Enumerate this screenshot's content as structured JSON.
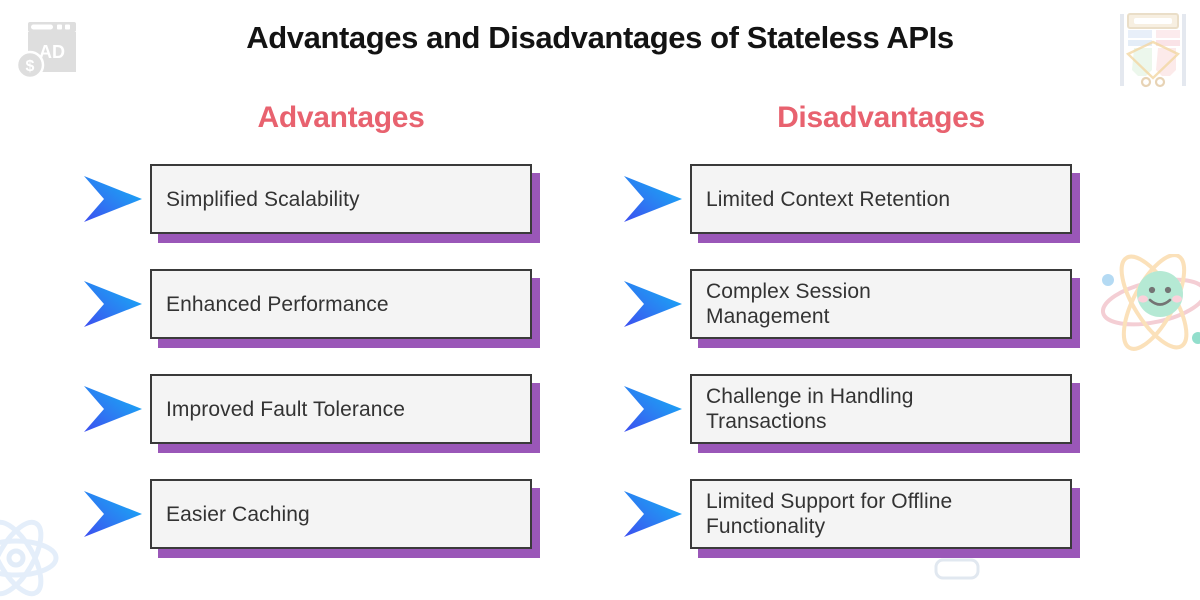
{
  "page": {
    "title": "Advantages and Disadvantages of Stateless APIs",
    "background_color": "#ffffff"
  },
  "theme": {
    "heading_color": "#e8626f",
    "title_color": "#131313",
    "box_fill": "#f4f4f4",
    "box_border": "#3a3a3a",
    "box_shadow_color": "#9a57b8",
    "text_color": "#333333",
    "arrow_gradient_from": "#13b5f5",
    "arrow_gradient_to": "#3a54f0"
  },
  "columns": {
    "left": {
      "heading": "Advantages",
      "items": [
        {
          "label": "Simplified Scalability",
          "arrow_icon": "arrow-right-icon"
        },
        {
          "label": "Enhanced Performance",
          "arrow_icon": "arrow-right-icon"
        },
        {
          "label": "Improved Fault Tolerance",
          "arrow_icon": "arrow-right-icon"
        },
        {
          "label": "Easier Caching",
          "arrow_icon": "arrow-right-icon"
        }
      ]
    },
    "right": {
      "heading": "Disadvantages",
      "items": [
        {
          "label": "Limited Context Retention",
          "arrow_icon": "arrow-right-icon"
        },
        {
          "label": "Complex Session\nManagement",
          "arrow_icon": "arrow-right-icon"
        },
        {
          "label": "Challenge in Handling\nTransactions",
          "arrow_icon": "arrow-right-icon"
        },
        {
          "label": "Limited Support for Offline\nFunctionality",
          "arrow_icon": "arrow-right-icon"
        }
      ]
    }
  },
  "decorations": [
    {
      "name": "ad-browser-window-icon",
      "label": "AD",
      "currency": "$",
      "position": "top-left",
      "color": "#dedede"
    },
    {
      "name": "clothing-rack-icon",
      "position": "top-right",
      "color": "#efe7d8"
    },
    {
      "name": "atom-smiley-face-icon",
      "position": "right-middle",
      "color": "#a9e6cd"
    },
    {
      "name": "react-atom-icon",
      "position": "bottom-left",
      "color": "#d8e6fa"
    },
    {
      "name": "rounded-pill-shape",
      "position": "bottom-right",
      "color": "#e4e9ef"
    }
  ]
}
